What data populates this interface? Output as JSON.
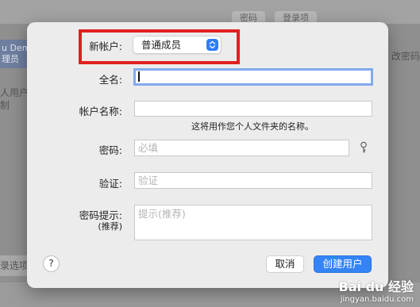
{
  "background": {
    "tabs": [
      "密码",
      "登录项"
    ],
    "left_user_name": "u Dem",
    "left_user_role": "理员",
    "left_lines": [
      "人用户",
      "制"
    ],
    "right_button": "改密码",
    "bottom_button": "录选项"
  },
  "dialog": {
    "new_account_label": "新帐户:",
    "new_account_value": "普通成员",
    "full_name_label": "全名:",
    "full_name_value": "",
    "account_name_label": "帐户名称:",
    "account_name_value": "",
    "account_name_hint": "这将用作您个人文件夹的名称。",
    "password_label": "密码:",
    "password_placeholder": "必填",
    "verify_label": "验证:",
    "verify_placeholder": "验证",
    "hint_label": "密码提示:",
    "hint_sublabel": "(推荐)",
    "hint_placeholder": "提示(推荐)",
    "help_label": "?",
    "cancel_label": "取消",
    "create_label": "创建用户"
  },
  "watermark": {
    "brand": "Bai du 经验",
    "url": "jingyan.baidu.com"
  },
  "colors": {
    "accent": "#3584f7",
    "highlight": "#e02020",
    "focus_ring": "#82aaed"
  }
}
